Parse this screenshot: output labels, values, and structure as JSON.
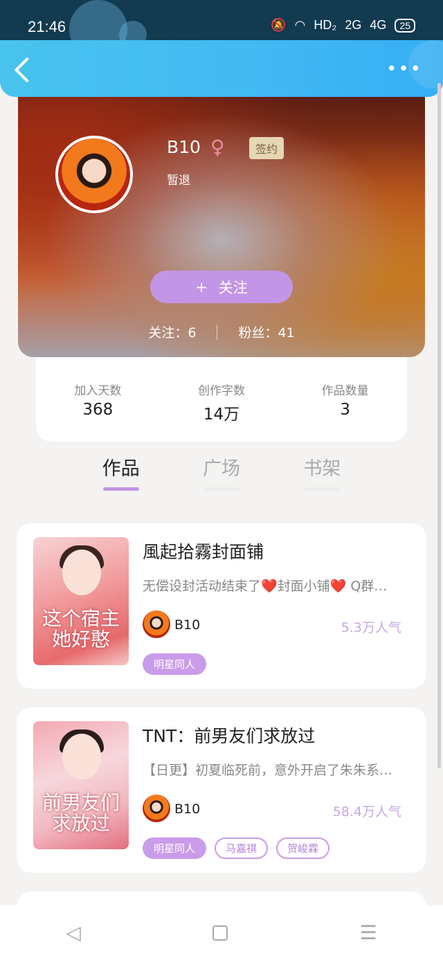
{
  "status_bar": {
    "time": "21:46",
    "network": "HD₂",
    "signal_1": "2G",
    "signal_2": "4G",
    "battery": "25"
  },
  "profile": {
    "name": "B10",
    "gender_symbol": "♀",
    "badge": "签约",
    "status": "暂退",
    "follow_button": {
      "icon": "+",
      "label": "关注"
    },
    "following": "关注：6",
    "followers": "粉丝：41"
  },
  "stats": [
    {
      "label": "加入天数",
      "value": "368"
    },
    {
      "label": "创作字数",
      "value": "14万"
    },
    {
      "label": "作品数量",
      "value": "3"
    }
  ],
  "tabs": [
    {
      "label": "作品",
      "active": true
    },
    {
      "label": "广场",
      "active": false
    },
    {
      "label": "书架",
      "active": false
    }
  ],
  "works": [
    {
      "title": "風起拾霧封面铺",
      "description": "无偿设封活动结束了❤️封面小铺❤️ Q群…",
      "cover_text": "这个宿主她好憨",
      "author": "B10",
      "popularity": "5.3万人气",
      "tags": [
        "明星同人"
      ]
    },
    {
      "title": "TNT：前男友们求放过",
      "description": "【日更】初夏临死前，意外开启了朱朱系…",
      "cover_text": "前男友们求放过",
      "author": "B10",
      "popularity": "58.4万人气",
      "tags": [
        "明星同人",
        "马嘉祺",
        "贺峻霖"
      ]
    }
  ],
  "nav": {
    "back": "◁",
    "menu": "☰"
  }
}
